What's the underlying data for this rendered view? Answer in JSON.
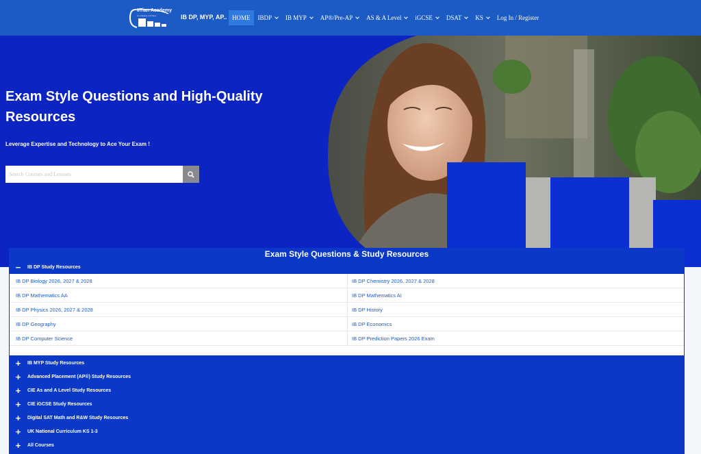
{
  "nav": {
    "logo": {
      "name": "IITian Academy",
      "tagline": "An initiative of IITians"
    },
    "brand": "IB DP, MYP, AP..",
    "items": [
      {
        "label": "HOME",
        "active": true,
        "dropdown": false
      },
      {
        "label": "IBDP",
        "active": false,
        "dropdown": true
      },
      {
        "label": "IB MYP",
        "active": false,
        "dropdown": true
      },
      {
        "label": "AP®/Pre-AP",
        "active": false,
        "dropdown": true
      },
      {
        "label": "AS & A Level",
        "active": false,
        "dropdown": true
      },
      {
        "label": "iGCSE",
        "active": false,
        "dropdown": true
      },
      {
        "label": "DSAT",
        "active": false,
        "dropdown": true
      },
      {
        "label": "KS",
        "active": false,
        "dropdown": true
      },
      {
        "label": "Log In / Register",
        "active": false,
        "dropdown": false
      }
    ]
  },
  "hero": {
    "title": "Exam Style Questions and High-Quality Resources",
    "subtitle": "Leverage Expertise and Technology to Ace Your Exam !",
    "search": {
      "placeholder": "Search Courses and Lessons",
      "value": "",
      "icon": "search-icon"
    }
  },
  "resources": {
    "title": "Exam Style Questions & Study Resources",
    "open_section": {
      "sign": "−",
      "label": "IB DP Study Resources",
      "rows": [
        {
          "left": "IB DP Biology 2026, 2027 & 2028",
          "right": "IB DP Chemistry 2026, 2027 & 2028"
        },
        {
          "left": "IB DP Mathematics AA",
          "right": "IB DP Mathematics AI"
        },
        {
          "left": "IB DP Physics 2026, 2027 & 2028",
          "right": "IB DP History"
        },
        {
          "left": "IB DP Geography",
          "right": "IB DP Economics"
        },
        {
          "left": "IB DP Computer Science",
          "right": "IB DP Prediction Papers 2026 Exam"
        }
      ]
    },
    "collapsed_sections": [
      {
        "sign": "+",
        "label": "IB MYP Study Resources"
      },
      {
        "sign": "+",
        "label": "Advanced Placement (AP®) Study Resources"
      },
      {
        "sign": "+",
        "label": "CIE As and A Level Study Resources"
      },
      {
        "sign": "+",
        "label": "CIE iGCSE Study Resources"
      },
      {
        "sign": "+",
        "label": "Digital SAT Math and R&W Study Resources"
      },
      {
        "sign": "+",
        "label": "UK National Curriculum KS 1-3"
      },
      {
        "sign": "+",
        "label": "All Courses"
      }
    ]
  },
  "colors": {
    "nav_bg": "#1c5bc4",
    "hero_bg": "#0b24c2",
    "panel_bg": "#0b38c6",
    "link": "#1c5bc4"
  }
}
